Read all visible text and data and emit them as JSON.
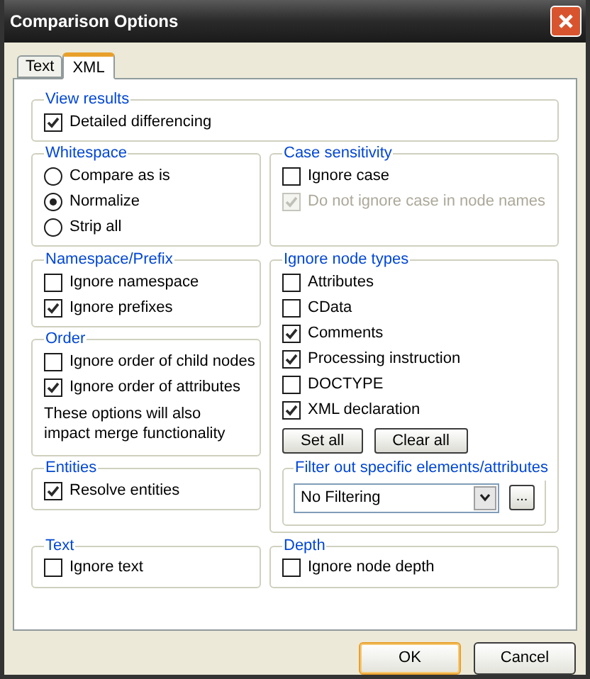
{
  "window": {
    "title": "Comparison Options"
  },
  "tabs": [
    {
      "label": "Text",
      "selected": false
    },
    {
      "label": "XML",
      "selected": true
    }
  ],
  "view_results": {
    "title": "View results",
    "items": [
      {
        "kind": "checkbox",
        "label": "Detailed differencing",
        "checked": true,
        "disabled": false
      }
    ]
  },
  "whitespace": {
    "title": "Whitespace",
    "items": [
      {
        "kind": "radio",
        "label": "Compare as is",
        "selected": false
      },
      {
        "kind": "radio",
        "label": "Normalize",
        "selected": true
      },
      {
        "kind": "radio",
        "label": "Strip all",
        "selected": false
      }
    ]
  },
  "case_sensitivity": {
    "title": "Case sensitivity",
    "items": [
      {
        "kind": "checkbox",
        "label": "Ignore case",
        "checked": false,
        "disabled": false
      },
      {
        "kind": "checkbox",
        "label": "Do not ignore case in node names",
        "checked": true,
        "disabled": true
      }
    ]
  },
  "namespace_prefix": {
    "title": "Namespace/Prefix",
    "items": [
      {
        "kind": "checkbox",
        "label": "Ignore namespace",
        "checked": false,
        "disabled": false
      },
      {
        "kind": "checkbox",
        "label": "Ignore prefixes",
        "checked": true,
        "disabled": false
      }
    ]
  },
  "order": {
    "title": "Order",
    "items": [
      {
        "kind": "checkbox",
        "label": "Ignore order of child nodes",
        "checked": false,
        "disabled": false
      },
      {
        "kind": "checkbox",
        "label": "Ignore order of attributes",
        "checked": true,
        "disabled": false
      },
      {
        "kind": "note",
        "label": "These options will also impact merge functionality"
      }
    ]
  },
  "entities": {
    "title": "Entities",
    "items": [
      {
        "kind": "checkbox",
        "label": "Resolve entities",
        "checked": true,
        "disabled": false
      }
    ]
  },
  "ignore_node_types": {
    "title": "Ignore node types",
    "items": [
      {
        "kind": "checkbox",
        "label": "Attributes",
        "checked": false,
        "disabled": false
      },
      {
        "kind": "checkbox",
        "label": "CData",
        "checked": false,
        "disabled": false
      },
      {
        "kind": "checkbox",
        "label": "Comments",
        "checked": true,
        "disabled": false
      },
      {
        "kind": "checkbox",
        "label": "Processing instruction",
        "checked": true,
        "disabled": false
      },
      {
        "kind": "checkbox",
        "label": "DOCTYPE",
        "checked": false,
        "disabled": false
      },
      {
        "kind": "checkbox",
        "label": "XML declaration",
        "checked": true,
        "disabled": false
      }
    ],
    "buttons": [
      "Set all",
      "Clear all"
    ],
    "filter": {
      "title": "Filter out specific elements/attributes",
      "value": "No Filtering",
      "browse": "..."
    }
  },
  "text": {
    "title": "Text",
    "items": [
      {
        "kind": "checkbox",
        "label": "Ignore text",
        "checked": false,
        "disabled": false
      }
    ]
  },
  "depth": {
    "title": "Depth",
    "items": [
      {
        "kind": "checkbox",
        "label": "Ignore node depth",
        "checked": false,
        "disabled": false
      }
    ]
  },
  "buttons": [
    {
      "label": "OK",
      "default": true
    },
    {
      "label": "Cancel",
      "default": false
    }
  ]
}
